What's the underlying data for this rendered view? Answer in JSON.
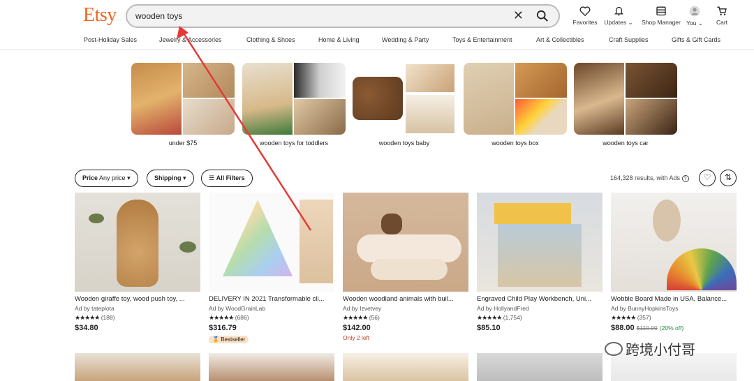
{
  "header": {
    "logo": "Etsy",
    "search_value": "wooden toys",
    "icons": [
      {
        "icon": "heart-icon",
        "label": "Favorites"
      },
      {
        "icon": "bell-icon",
        "label": "Updates"
      },
      {
        "icon": "shop-icon",
        "label": "Shop Manager"
      },
      {
        "icon": "avatar-icon",
        "label": "You"
      },
      {
        "icon": "cart-icon",
        "label": "Cart"
      }
    ]
  },
  "categories": [
    "Post-Holiday Sales",
    "Jewelry & Accessories",
    "Clothing & Shoes",
    "Home & Living",
    "Wedding & Party",
    "Toys & Entertainment",
    "Art & Collectibles",
    "Craft Supplies",
    "Gifts & Gift Cards"
  ],
  "suggestions": [
    "under $75",
    "wooden toys for toddlers",
    "wooden toys baby",
    "wooden toys box",
    "wooden toys car"
  ],
  "filters": {
    "price_label": "Price",
    "price_value": "Any price",
    "shipping": "Shipping",
    "all_filters": "All Filters",
    "results": "164,328 results, with Ads"
  },
  "products": [
    {
      "title": "Wooden giraffe toy, wood push toy, ...",
      "shop": "Ad by tateplota",
      "stars": "★★★★★",
      "reviews": "(188)",
      "price": "$34.80"
    },
    {
      "title": "DELIVERY IN 2021 Transformable cli...",
      "shop": "Ad by WoodGrainLab",
      "stars": "★★★★★",
      "reviews": "(686)",
      "price": "$316.79",
      "badge": "Bestseller"
    },
    {
      "title": "Wooden woodland animals with buil...",
      "shop": "Ad by Izvetvey",
      "stars": "★★★★★",
      "reviews": "(56)",
      "price": "$142.00",
      "note": "Only 2 left"
    },
    {
      "title": "Engraved Child Play Workbench, Uni...",
      "shop": "Ad by HollyandFred",
      "stars": "★★★★★",
      "reviews": "(1,754)",
      "price": "$85.10"
    },
    {
      "title": "Wobble Board Made in USA, Balance...",
      "shop": "Ad by BunnyHopkinsToys",
      "stars": "★★★★★",
      "reviews": "(357)",
      "price": "$88.00",
      "orig": "$110.00",
      "off": "(20% off)"
    }
  ],
  "watermark": "跨境小付哥"
}
